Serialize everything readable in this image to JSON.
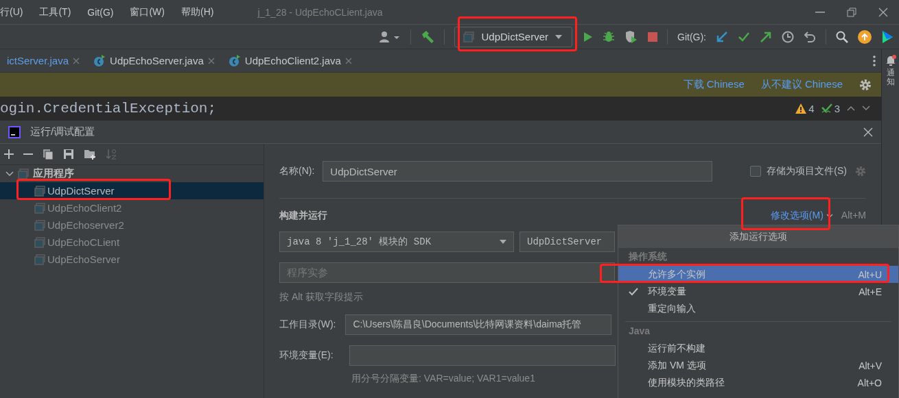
{
  "menu": [
    "行(U)",
    "工具(T)",
    "Git(G)",
    "窗口(W)",
    "帮助(H)"
  ],
  "window": {
    "title": "j_1_28 - UdpEchoCLient.java"
  },
  "toolbar": {
    "run_config": "UdpDictServer",
    "git_label": "Git(G):"
  },
  "tabs": [
    {
      "label": "ictServer.java",
      "selected": true,
      "kind": "plain"
    },
    {
      "label": "UdpEchoServer.java",
      "selected": false,
      "kind": "class"
    },
    {
      "label": "UdpEchoClient2.java",
      "selected": false,
      "kind": "class"
    }
  ],
  "notifications_label": "通知",
  "banner": {
    "links": [
      "下载 Chinese",
      "从不建议 Chinese"
    ]
  },
  "code_line": "ogin.CredentialException;",
  "inspections": {
    "warnings": "4",
    "weak_warnings": "3"
  },
  "dialog": {
    "title": "运行/调试配置",
    "tree": [
      {
        "label": "应用程序",
        "expanded": true,
        "children": [
          {
            "label": "UdpDictServer",
            "selected": true
          },
          {
            "label": "UdpEchoClient2",
            "selected": false
          },
          {
            "label": "UdpEchoserver2",
            "selected": false
          },
          {
            "label": "UdpEchoCLient",
            "selected": false
          },
          {
            "label": "UdpEchoServer",
            "selected": false
          }
        ]
      }
    ],
    "name_label": "名称(N):",
    "name_value": "UdpDictServer",
    "store_label": "存储为项目文件(S)",
    "store_checked": false,
    "section": "构建并运行",
    "modify_link": "修改选项(M)",
    "modify_shortcut": "Alt+M",
    "sdk": "java 8 'j_1_28' 模块的 SDK",
    "main_class": "UdpDictServer",
    "args_placeholder": "程序实参",
    "alt_hint": "按 Alt 获取字段提示",
    "workdir_label": "工作目录(W):",
    "workdir_value": "C:\\Users\\陈昌良\\Documents\\比特网课资料\\daima托管",
    "env_label": "环境变量(E):",
    "env_hint": "用分号分隔变量: VAR=value; VAR1=value1"
  },
  "popup": {
    "title": "添加运行选项",
    "sections": [
      {
        "heading": "操作系统",
        "items": [
          {
            "label": "允许多个实例",
            "shortcut": "Alt+U",
            "selected": true,
            "checked": false
          },
          {
            "label": "环境变量",
            "shortcut": "Alt+E",
            "selected": false,
            "checked": true
          },
          {
            "label": "重定向输入",
            "selected": false,
            "checked": false
          }
        ]
      },
      {
        "heading": "Java",
        "items": [
          {
            "label": "运行前不构建",
            "selected": false,
            "checked": false
          },
          {
            "label": "添加 VM 选项",
            "shortcut": "Alt+V",
            "selected": false,
            "checked": false
          },
          {
            "label": "使用模块的类路径",
            "shortcut": "Alt+O",
            "selected": false,
            "checked": false
          }
        ]
      }
    ]
  }
}
